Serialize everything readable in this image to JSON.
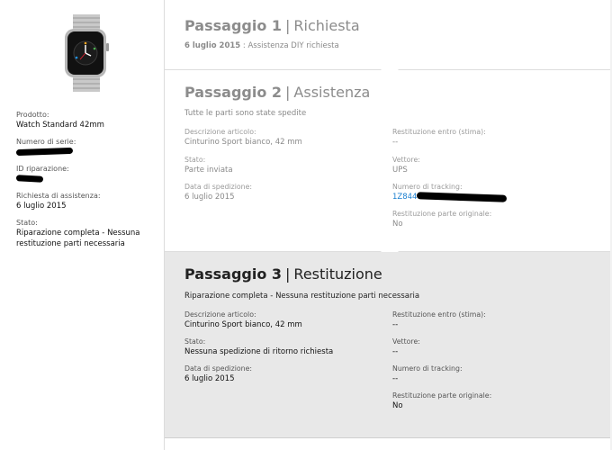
{
  "sidebar": {
    "product_label": "Prodotto:",
    "product_value": "Watch Standard 42mm",
    "serial_label": "Numero di serie:",
    "repair_id_label": "ID riparazione:",
    "request_label": "Richiesta di assistenza:",
    "request_value": "6 luglio 2015",
    "status_label": "Stato:",
    "status_value": "Riparazione completa - Nessuna restituzione parti necessaria"
  },
  "step1": {
    "number": "Passaggio 1",
    "name": "Richiesta",
    "date": "6 luglio 2015",
    "note": ": Assistenza DIY richiesta"
  },
  "step2": {
    "number": "Passaggio 2",
    "name": "Assistenza",
    "summary": "Tutte le parti sono state spedite",
    "desc_label": "Descrizione articolo:",
    "desc_value": "Cinturino Sport bianco, 42 mm",
    "state_label": "Stato:",
    "state_value": "Parte inviata",
    "ship_label": "Data di spedizione:",
    "ship_value": "6 luglio 2015",
    "return_by_label": "Restituzione entro (stima):",
    "return_by_value": "--",
    "carrier_label": "Vettore:",
    "carrier_value": "UPS",
    "tracking_label": "Numero di tracking:",
    "tracking_value": "1Z844",
    "orig_return_label": "Restituzione parte originale:",
    "orig_return_value": "No"
  },
  "step3": {
    "number": "Passaggio 3",
    "name": "Restituzione",
    "summary": "Riparazione completa - Nessuna restituzione parti necessaria",
    "desc_label": "Descrizione articolo:",
    "desc_value": "Cinturino Sport bianco, 42 mm",
    "state_label": "Stato:",
    "state_value": "Nessuna spedizione di ritorno richiesta",
    "ship_label": "Data di spedizione:",
    "ship_value": "6 luglio 2015",
    "return_by_label": "Restituzione entro (stima):",
    "return_by_value": "--",
    "carrier_label": "Vettore:",
    "carrier_value": "--",
    "tracking_label": "Numero di tracking:",
    "tracking_value": "--",
    "orig_return_label": "Restituzione parte originale:",
    "orig_return_value": "No"
  }
}
